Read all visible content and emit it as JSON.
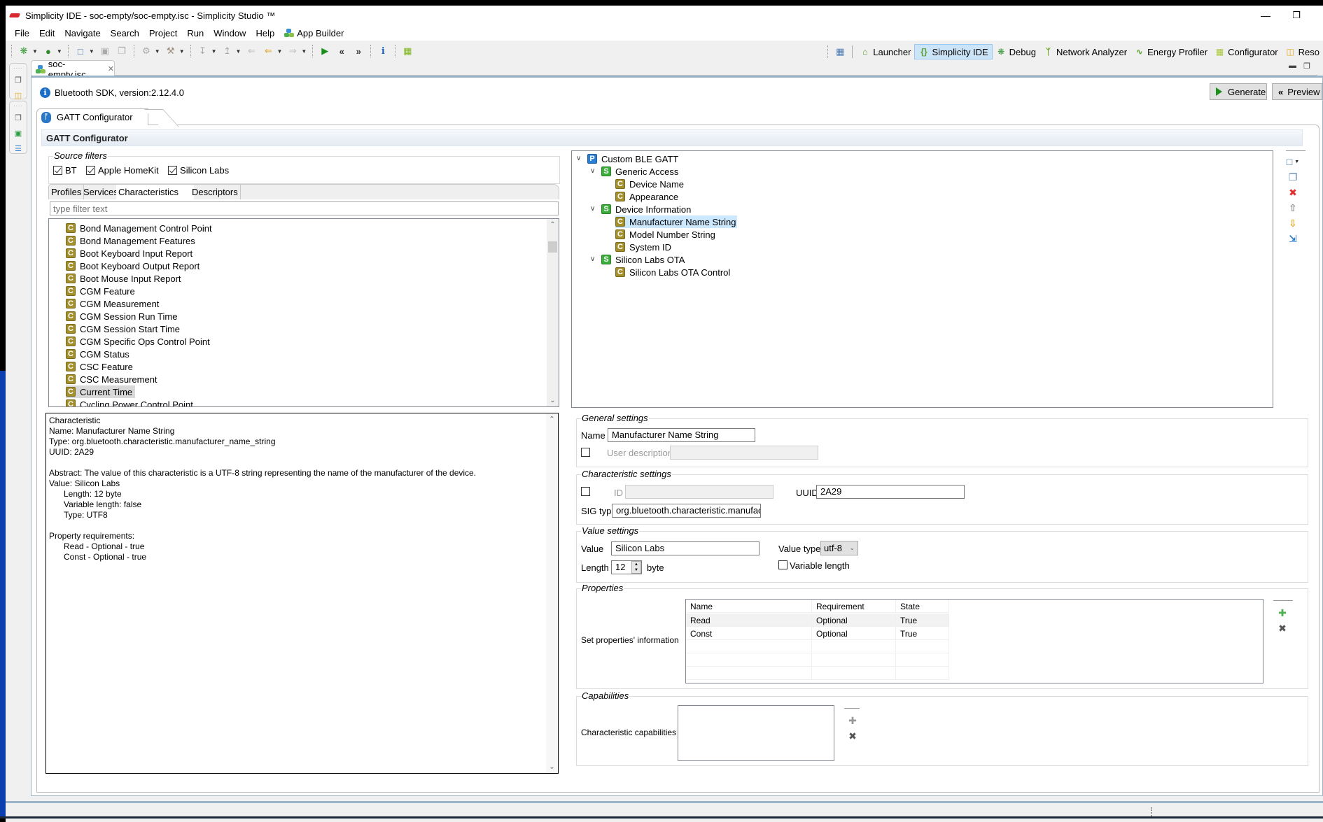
{
  "window": {
    "title": "Simplicity IDE - soc-empty/soc-empty.isc - Simplicity Studio ™",
    "minimize_glyph": "—",
    "restore_glyph": "❐"
  },
  "menu": {
    "items": [
      "File",
      "Edit",
      "Navigate",
      "Search",
      "Project",
      "Run",
      "Window",
      "Help"
    ],
    "app_builder": "App Builder"
  },
  "perspectives": {
    "items": [
      {
        "label": "Launcher",
        "icon": "home-icon",
        "active": false
      },
      {
        "label": "Simplicity IDE",
        "icon": "braces-icon",
        "active": true
      },
      {
        "label": "Debug",
        "icon": "bug-icon",
        "active": false
      },
      {
        "label": "Network Analyzer",
        "icon": "network-icon",
        "active": false
      },
      {
        "label": "Energy Profiler",
        "icon": "pulse-icon",
        "active": false
      },
      {
        "label": "Configurator",
        "icon": "chip-icon",
        "active": false
      },
      {
        "label": "Reso",
        "icon": "resources-icon",
        "active": false
      }
    ]
  },
  "editor": {
    "tab_label": "soc-empty.isc",
    "sdk_info": "Bluetooth SDK, version:2.12.4.0",
    "generate_label": "Generate",
    "preview_label": "Preview",
    "config_tab_label": "GATT Configurator",
    "header_title": "GATT Configurator"
  },
  "source_filters": {
    "title": "Source filters",
    "items": [
      {
        "label": "BT",
        "checked": true
      },
      {
        "label": "Apple HomeKit",
        "checked": true
      },
      {
        "label": "Silicon Labs",
        "checked": true
      }
    ]
  },
  "catalog_tabs": [
    "Profiles",
    "Services",
    "Characteristics",
    "Descriptors"
  ],
  "catalog_active_tab": "Characteristics",
  "filter": {
    "placeholder": "type filter text",
    "value": ""
  },
  "characteristics_list": [
    "Bond Management Control Point",
    "Bond Management Features",
    "Boot Keyboard Input Report",
    "Boot Keyboard Output Report",
    "Boot Mouse Input Report",
    "CGM Feature",
    "CGM Measurement",
    "CGM Session Run Time",
    "CGM Session Start Time",
    "CGM Specific Ops Control Point",
    "CGM Status",
    "CSC Feature",
    "CSC Measurement",
    "Current Time",
    "Cycling Power Control Point"
  ],
  "characteristics_selected": "Current Time",
  "details": {
    "heading": "Characteristic",
    "name": "Name: Manufacturer Name String",
    "type": "Type: org.bluetooth.characteristic.manufacturer_name_string",
    "uuid": "UUID: 2A29",
    "abstract": "Abstract: The value of this characteristic is a UTF-8 string representing the name of the manufacturer of the device.",
    "value": "Value: Silicon Labs",
    "length": "Length: 12 byte",
    "variable_length": "Variable length: false",
    "value_type": "Type: UTF8",
    "property_requirements": "Property requirements:",
    "req_read": "Read - Optional - true",
    "req_const": "Const - Optional - true"
  },
  "gatt_tree": {
    "root": {
      "label": "Custom BLE GATT",
      "badge": "P"
    },
    "services": [
      {
        "label": "Generic Access",
        "badge": "S",
        "characteristics": [
          "Device Name",
          "Appearance"
        ]
      },
      {
        "label": "Device Information",
        "badge": "S",
        "characteristics": [
          "Manufacturer Name String",
          "Model Number String",
          "System ID"
        ]
      },
      {
        "label": "Silicon Labs OTA",
        "badge": "S",
        "characteristics": [
          "Silicon Labs OTA Control"
        ]
      }
    ],
    "selected": "Manufacturer Name String",
    "char_badge": "C"
  },
  "general_settings": {
    "title": "General settings",
    "name_label": "Name",
    "name_value": "Manufacturer Name String",
    "user_description_label": "User description",
    "user_description_checked": false,
    "user_description_value": ""
  },
  "characteristic_settings": {
    "title": "Characteristic settings",
    "id_label": "ID",
    "id_checked": false,
    "id_value": "",
    "uuid_label": "UUID",
    "uuid_value": "2A29",
    "sig_type_label": "SIG type",
    "sig_type_value": "org.bluetooth.characteristic.manufacturer_name_string"
  },
  "value_settings": {
    "title": "Value settings",
    "value_label": "Value",
    "value": "Silicon Labs",
    "value_type_label": "Value type",
    "value_type": "utf-8",
    "length_label": "Length",
    "length": "12",
    "length_unit": "byte",
    "variable_length_label": "Variable length",
    "variable_length_checked": false
  },
  "properties": {
    "title": "Properties",
    "set_label": "Set properties' information",
    "columns": [
      "Name",
      "Requirement",
      "State"
    ],
    "rows": [
      [
        "Read",
        "Optional",
        "True"
      ],
      [
        "Const",
        "Optional",
        "True"
      ]
    ]
  },
  "capabilities": {
    "title": "Capabilities",
    "label": "Characteristic capabilities",
    "items": []
  }
}
